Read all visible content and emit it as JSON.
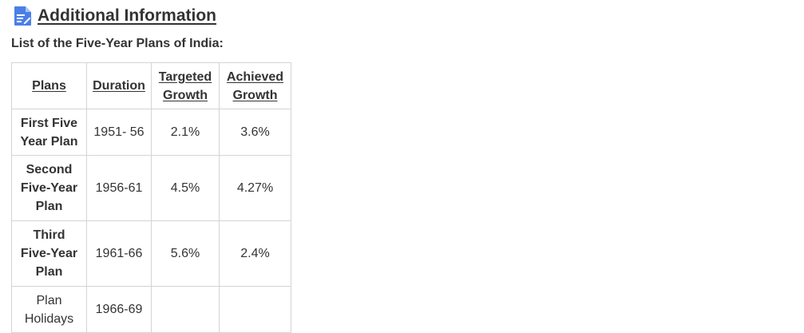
{
  "heading": {
    "icon": "document-icon",
    "title": "Additional Information",
    "icon_color": "#4a7fe8"
  },
  "subtitle": "List of the Five-Year Plans of India:",
  "table": {
    "headers": {
      "plans": "Plans",
      "duration": "Duration",
      "targeted_line1": "Targeted",
      "targeted_line2": "Growth",
      "achieved_line1": "Achieved",
      "achieved_line2": "Growth"
    },
    "rows": [
      {
        "plan": "First Five Year Plan",
        "duration": "1951- 56",
        "targeted": "2.1%",
        "achieved": "3.6%"
      },
      {
        "plan": "Second Five-Year Plan",
        "duration": "1956-61",
        "targeted": "4.5%",
        "achieved": "4.27%"
      },
      {
        "plan": "Third Five-Year Plan",
        "duration": "1961-66",
        "targeted": "5.6%",
        "achieved": "2.4%"
      },
      {
        "plan": "Plan Holidays",
        "duration": "1966-69",
        "targeted": "",
        "achieved": ""
      }
    ]
  }
}
